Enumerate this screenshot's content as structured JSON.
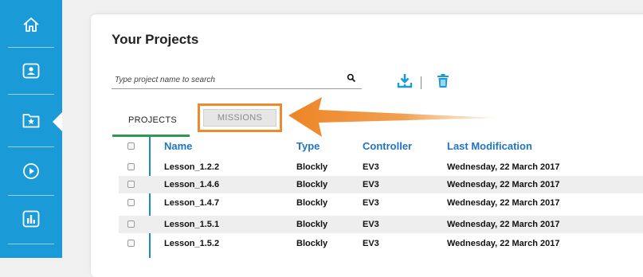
{
  "sidebar": {
    "items": [
      {
        "icon": "home-icon"
      },
      {
        "icon": "profile-folder-icon"
      },
      {
        "icon": "star-folder-icon",
        "active": true
      },
      {
        "icon": "play-circle-icon"
      },
      {
        "icon": "bar-chart-icon"
      }
    ],
    "color": "#1a9bd7"
  },
  "header": {
    "title": "Your Projects"
  },
  "search": {
    "placeholder": "Type project name to search",
    "value": ""
  },
  "toolbar": {
    "download_icon": "download-icon",
    "delete_icon": "trash-icon",
    "accent": "#1a9bd7"
  },
  "tabs": [
    {
      "label": "PROJECTS",
      "active": true
    },
    {
      "label": "MISSIONS",
      "active": false,
      "highlighted": true
    }
  ],
  "annotation": {
    "highlight_color": "#ec8a2c"
  },
  "table": {
    "headers": [
      "Name",
      "Type",
      "Controller",
      "Last Modification"
    ],
    "rows": [
      {
        "name": "Lesson_1.2.2",
        "type": "Blockly",
        "controller": "EV3",
        "modified": "Wednesday, 22 March 2017"
      },
      {
        "name": "Lesson_1.4.6",
        "type": "Blockly",
        "controller": "EV3",
        "modified": "Wednesday, 22 March 2017"
      },
      {
        "name": "Lesson_1.4.7",
        "type": "Blockly",
        "controller": "EV3",
        "modified": "Wednesday, 22 March 2017"
      },
      {
        "name": "Lesson_1.5.1",
        "type": "Blockly",
        "controller": "EV3",
        "modified": "Wednesday, 22 March 2017"
      },
      {
        "name": "Lesson_1.5.2",
        "type": "Blockly",
        "controller": "EV3",
        "modified": "Wednesday, 22 March 2017"
      }
    ]
  }
}
